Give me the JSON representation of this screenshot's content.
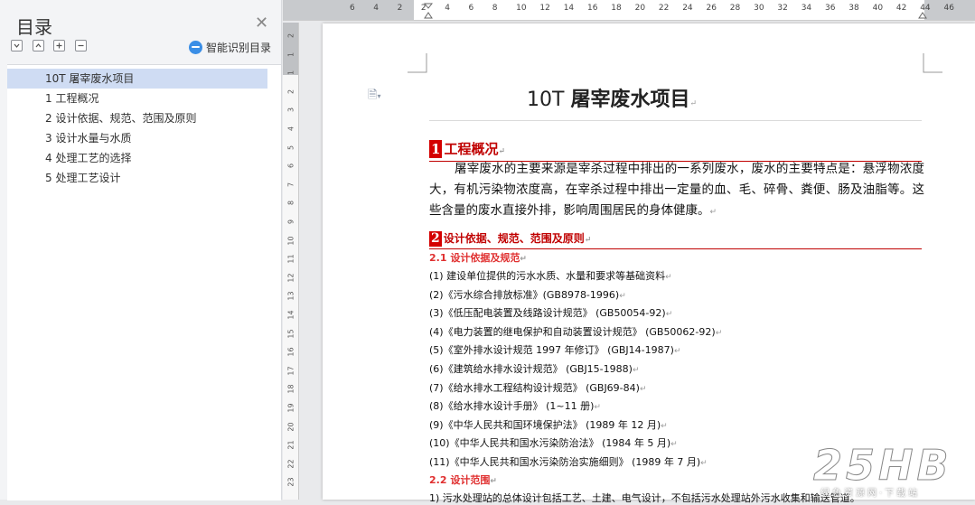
{
  "nav": {
    "title": "目录",
    "smart_label": "智能识别目录",
    "items": [
      "10T 屠宰废水项目",
      "1 工程概况",
      "2 设计依据、规范、范围及原则",
      "3 设计水量与水质",
      "4 处理工艺的选择",
      "5 处理工艺设计"
    ]
  },
  "hruler": [
    "6",
    "4",
    "2",
    "2",
    "4",
    "6",
    "8",
    "10",
    "12",
    "14",
    "16",
    "18",
    "20",
    "22",
    "24",
    "26",
    "28",
    "30",
    "32",
    "34",
    "36",
    "38",
    "40",
    "42",
    "44",
    "46"
  ],
  "vruler": [
    "2",
    "1",
    "1",
    "2",
    "3",
    "4",
    "5",
    "6",
    "7",
    "8",
    "9",
    "10",
    "11",
    "12",
    "13",
    "14",
    "15",
    "16",
    "17",
    "18",
    "19",
    "20",
    "21",
    "22",
    "23"
  ],
  "doc": {
    "title_num": "10T",
    "title_text": "屠宰废水项目",
    "mark": "↵",
    "s1_num": "1",
    "s1_title": "工程概况",
    "s1_para": "屠宰废水的主要来源是宰杀过程中排出的一系列废水，废水的主要特点是：悬浮物浓度大，有机污染物浓度高，在宰杀过程中排出一定量的血、毛、碎骨、粪便、肠及油脂等。这些含量的废水直接外排，影响周围居民的身体健康。",
    "s2_num": "2",
    "s2_title": "设计依据、规范、范围及原则",
    "s21_title": "2.1 设计依据及规范",
    "refs": [
      "(1) 建设单位提供的污水水质、水量和要求等基础资料",
      "(2)《污水综合排放标准》(GB8978-1996)",
      "(3)《低压配电装置及线路设计规范》 (GB50054-92)",
      "(4)《电力装置的继电保护和自动装置设计规范》 (GB50062-92)",
      "(5)《室外排水设计规范 1997 年修订》 (GBJ14-1987)",
      "(6)《建筑给水排水设计规范》 (GBJ15-1988)",
      "(7)《给水排水工程结构设计规范》 (GBJ69-84)",
      "(8)《给水排水设计手册》 (1~11 册)",
      "(9)《中华人民共和国环境保护法》 (1989 年 12 月)",
      "(10)《中华人民共和国水污染防治法》 (1984 年 5 月)",
      "(11)《中华人民共和国水污染防治实施细则》 (1989 年 7 月)"
    ],
    "s22_title": "2.2 设计范围",
    "s22_line": "1) 污水处理站的总体设计包括工艺、土建、电气设计，不包括污水处理站外污水收集和输送管道。"
  },
  "watermark": {
    "logo": "25HB",
    "sub": "绿色资源网·下载站"
  }
}
